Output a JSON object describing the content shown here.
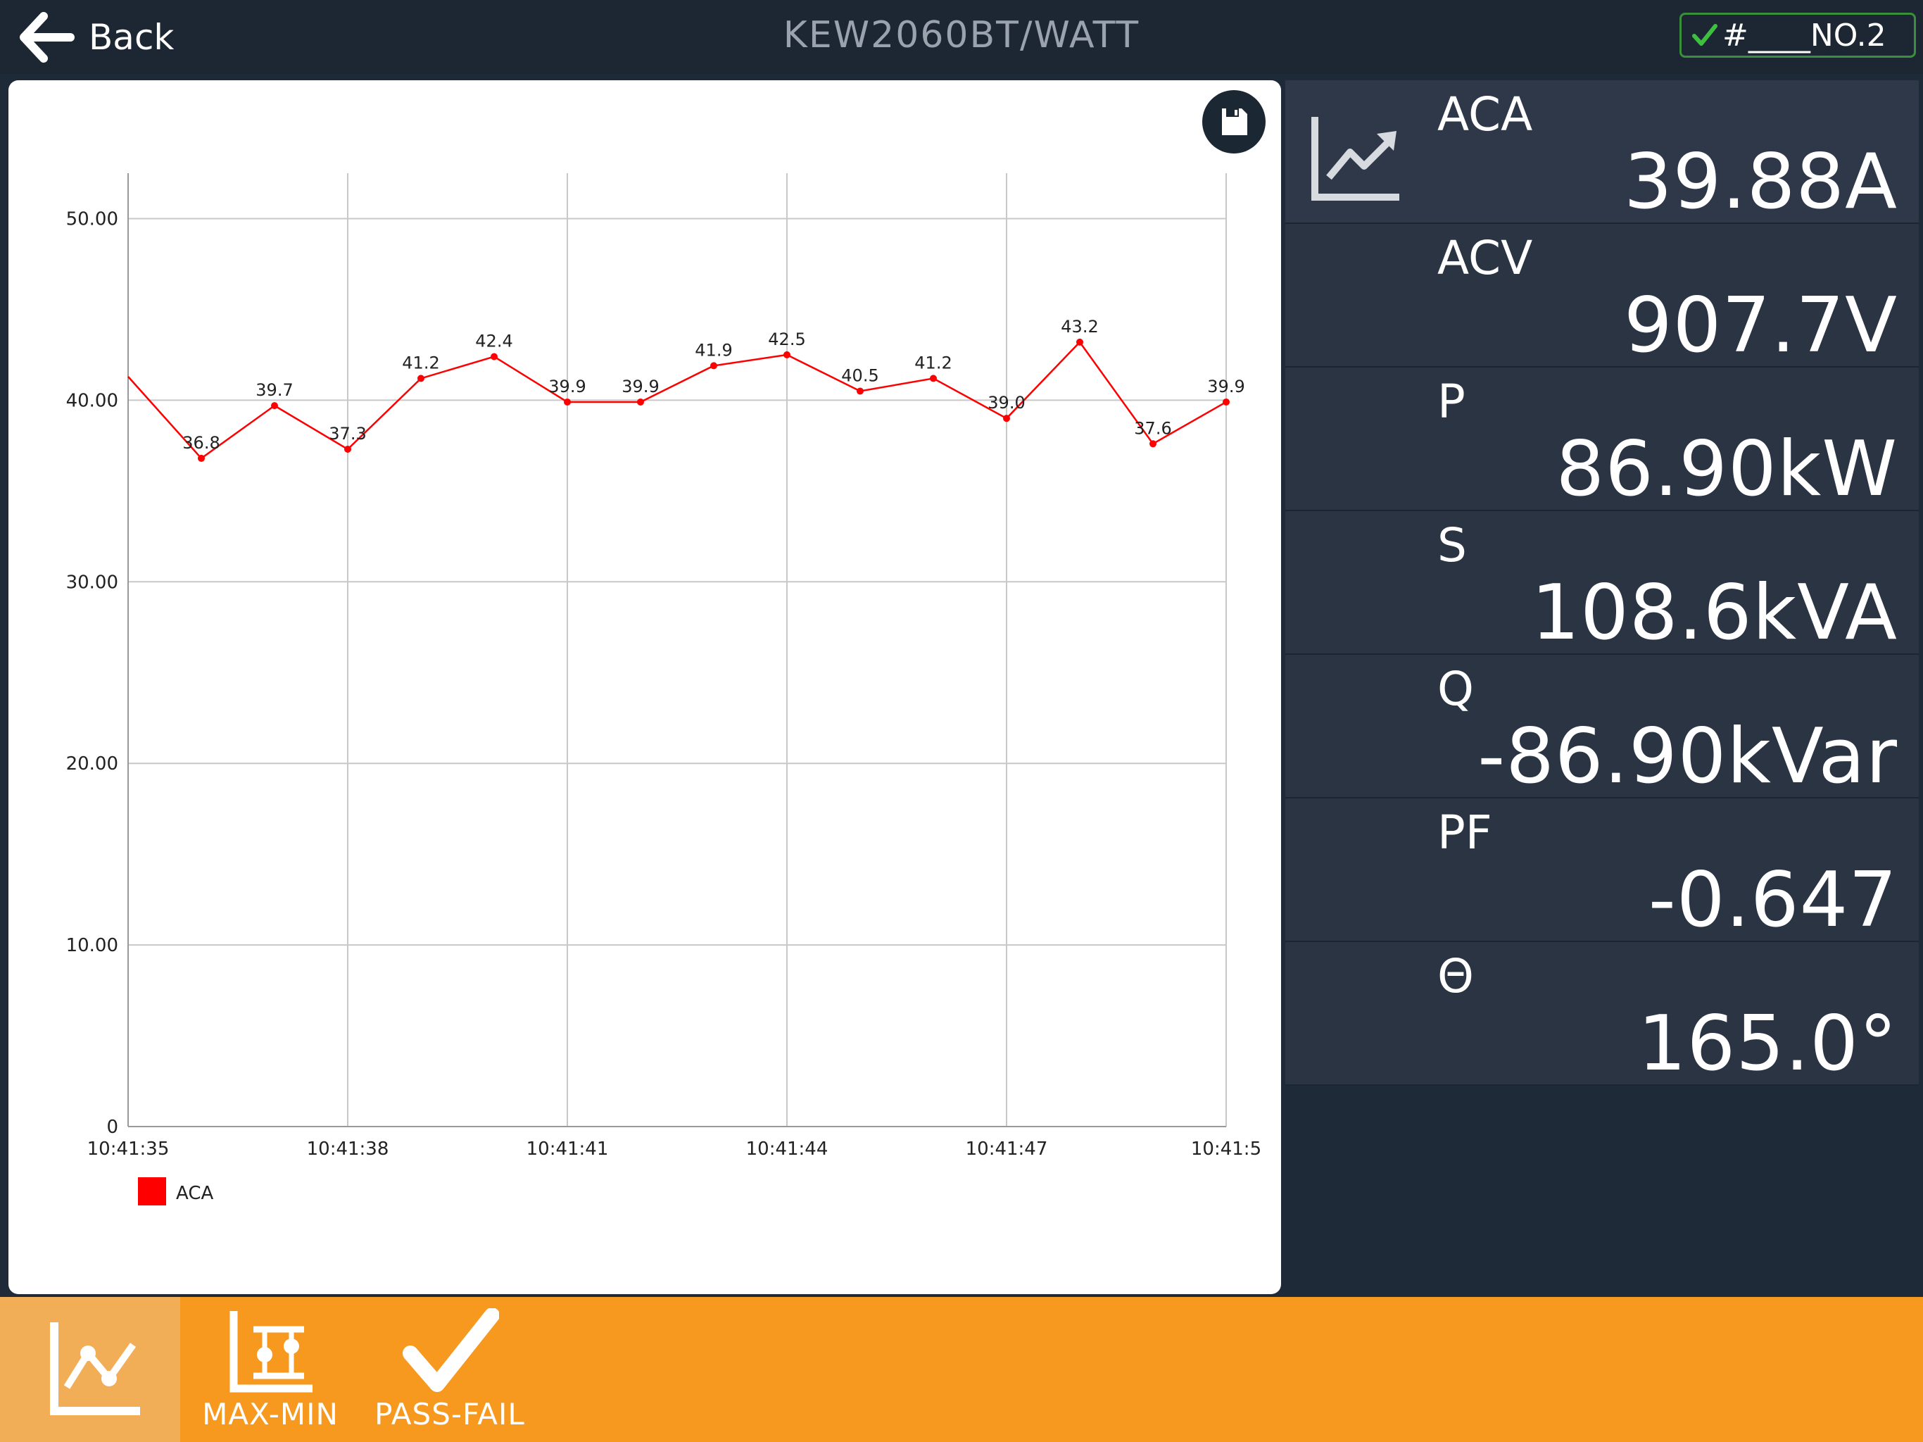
{
  "header": {
    "back_label": "Back",
    "title": "KEW2060BT/WATT",
    "device_label": "#____NO.2"
  },
  "metrics": [
    {
      "label": "ACA",
      "value": "39.88A"
    },
    {
      "label": "ACV",
      "value": "907.7V"
    },
    {
      "label": "P",
      "value": "86.90kW"
    },
    {
      "label": "S",
      "value": "108.6kVA"
    },
    {
      "label": "Q",
      "value": "-86.90kVar"
    },
    {
      "label": "PF",
      "value": "-0.647"
    },
    {
      "label": "Θ",
      "value": "165.0°"
    }
  ],
  "tabs": [
    {
      "label": "",
      "icon": "trend-chart-icon",
      "active": true
    },
    {
      "label": "MAX-MIN",
      "icon": "max-min-icon",
      "active": false
    },
    {
      "label": "PASS-FAIL",
      "icon": "check-icon",
      "active": false
    }
  ],
  "colors": {
    "accent": "#f7981f",
    "series": "#ff0000",
    "panel_bg": "#2a3443",
    "header_bg": "#1d2734"
  },
  "chart_data": {
    "type": "line",
    "ylim": [
      0,
      52.5
    ],
    "yticks": [
      0,
      10,
      20,
      30,
      40,
      50
    ],
    "ytick_labels": [
      "0",
      "10.00",
      "20.00",
      "30.00",
      "40.00",
      "50.00"
    ],
    "xtick_labels": [
      "10:41:35",
      "10:41:38",
      "10:41:41",
      "10:41:44",
      "10:41:47",
      "10:41:5"
    ],
    "grid": true,
    "legend": "bottom-left",
    "series": [
      {
        "name": "ACA",
        "color": "#ff0000",
        "values": [
          41.3,
          36.8,
          39.7,
          37.3,
          41.2,
          42.4,
          39.9,
          39.9,
          41.9,
          42.5,
          40.5,
          41.2,
          39.0,
          43.2,
          37.6,
          39.9
        ],
        "labels": [
          "",
          "36.8",
          "39.7",
          "37.3",
          "41.2",
          "42.4",
          "39.9",
          "39.9",
          "41.9",
          "42.5",
          "40.5",
          "41.2",
          "39.0",
          "43.2",
          "37.6",
          "39.9"
        ]
      }
    ]
  }
}
